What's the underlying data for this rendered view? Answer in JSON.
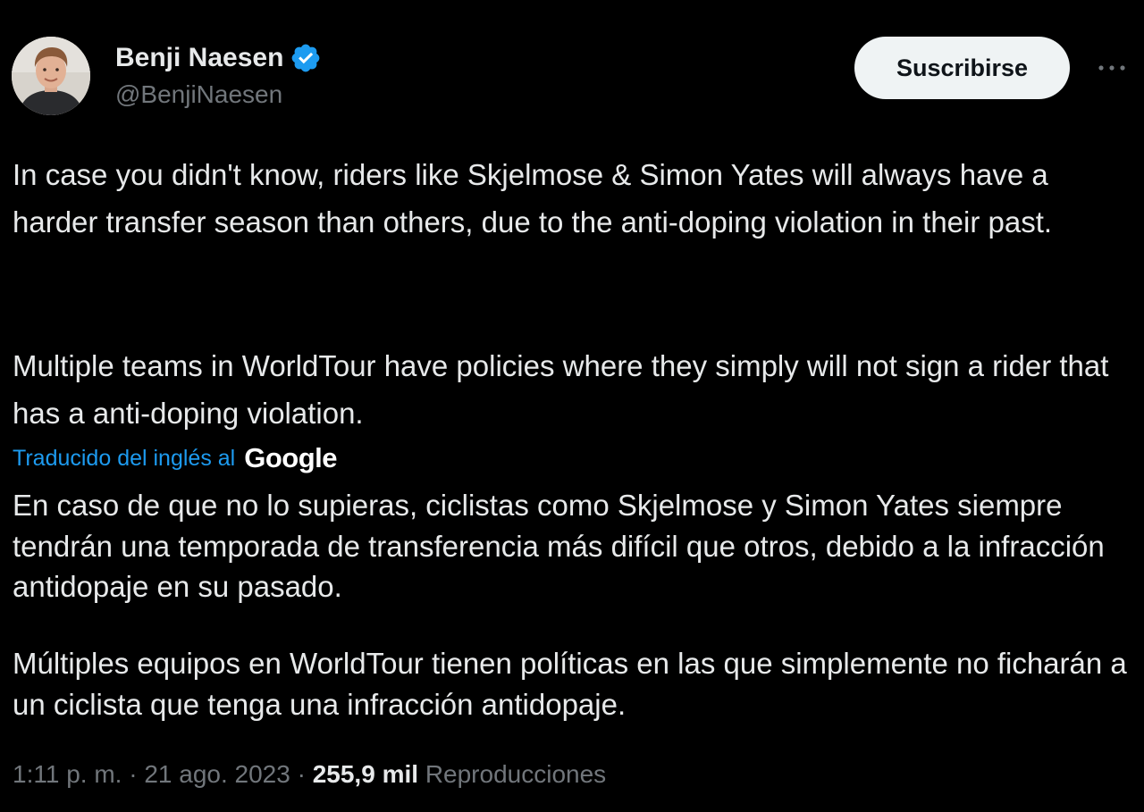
{
  "author": {
    "display_name": "Benji Naesen",
    "handle": "@BenjiNaesen",
    "verified_icon": "verified-badge-icon",
    "verified_color": "#1d9bf0"
  },
  "actions": {
    "subscribe_label": "Suscribirse",
    "more_icon": "more-horizontal-icon"
  },
  "tweet": {
    "original_paragraphs": [
      "In case you didn't know, riders like Skjelmose & Simon Yates will always have a harder transfer season than others, due to the anti-doping violation in their past.",
      "Multiple teams in WorldTour have policies where they simply will not sign a rider that has a anti-doping violation."
    ],
    "translation_label": "Traducido del inglés al",
    "translation_provider": "Google",
    "translated_paragraphs": [
      "En caso de que no lo supieras, ciclistas como Skjelmose y Simon Yates siempre tendrán una temporada de transferencia más difícil que otros, debido a la infracción antidopaje en su pasado.",
      "Múltiples equipos en WorldTour tienen políticas en las que simplemente no ficharán a un ciclista que tenga una infracción antidopaje."
    ]
  },
  "meta": {
    "time": "1:11 p. m.",
    "separator": " · ",
    "date": "21 ago. 2023",
    "views_count": "255,9 mil",
    "views_label": "Reproducciones"
  },
  "colors": {
    "background": "#000000",
    "text_primary": "#e7e9ea",
    "text_secondary": "#71767b",
    "accent": "#1d9bf0",
    "button_bg": "#eff3f4"
  }
}
